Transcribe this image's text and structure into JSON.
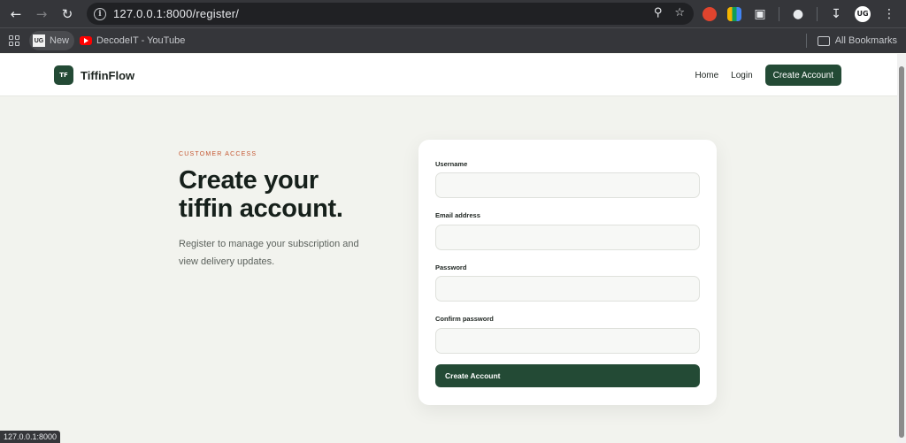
{
  "browser": {
    "url": "127.0.0.1:8000/register/",
    "bookmarks": [
      {
        "label": "New",
        "icon": "uc-logo"
      },
      {
        "label": "DecodeIT - YouTube",
        "icon": "youtube-icon"
      }
    ],
    "all_bookmarks_label": "All Bookmarks",
    "profile_initials": "UG",
    "status_url": "127.0.0.1:8000"
  },
  "site": {
    "brand_mark": "TF",
    "brand_name": "TiffinFlow",
    "nav": {
      "home": "Home",
      "login": "Login",
      "cta": "Create Account"
    }
  },
  "hero": {
    "eyebrow": "CUSTOMER ACCESS",
    "title_line1": "Create your",
    "title_line2": "tiffin account.",
    "subtitle": "Register to manage your subscription and view delivery updates."
  },
  "form": {
    "fields": [
      {
        "label": "Username",
        "value": ""
      },
      {
        "label": "Email address",
        "value": ""
      },
      {
        "label": "Password",
        "value": ""
      },
      {
        "label": "Confirm password",
        "value": ""
      }
    ],
    "submit_label": "Create Account"
  },
  "colors": {
    "primary": "#234a35",
    "accent": "#c4552f",
    "background": "#f2f3ee"
  }
}
